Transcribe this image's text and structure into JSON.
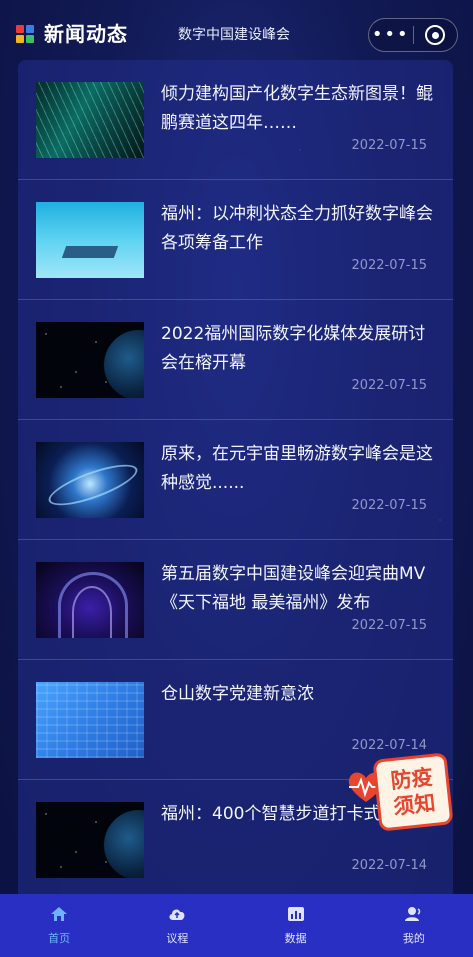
{
  "header": {
    "title": "新闻动态",
    "subtitle": "数字中国建设峰会",
    "more_label": "•••"
  },
  "news": [
    {
      "title": "倾力建构国产化数字生态新图景！鲲鹏赛道这四年……",
      "date": "2022-07-15",
      "thumb": "glowing-lines"
    },
    {
      "title": "福州：以冲刺状态全力抓好数字峰会各项筹备工作",
      "date": "2022-07-15",
      "thumb": "tech-platform"
    },
    {
      "title": "2022福州国际数字化媒体发展研讨会在榕开幕",
      "date": "2022-07-15",
      "thumb": "earth-space"
    },
    {
      "title": "原来，在元宇宙里畅游数字峰会是这种感觉......",
      "date": "2022-07-15",
      "thumb": "metaverse-orbit"
    },
    {
      "title": "第五届数字中国建设峰会迎宾曲MV《天下福地 最美福州》发布",
      "date": "2022-07-15",
      "thumb": "tunnel-arch"
    },
    {
      "title": "仓山数字党建新意浓",
      "date": "2022-07-14",
      "thumb": "blue-circuit"
    },
    {
      "title": "福州：400个智慧步道打卡式上线",
      "date": "2022-07-14",
      "thumb": "earth-space"
    }
  ],
  "epidemic_badge": {
    "line1": "防疫",
    "line2": "须知"
  },
  "tabbar": {
    "items": [
      {
        "label": "首页",
        "icon": "home-icon",
        "active": true
      },
      {
        "label": "议程",
        "icon": "cloud-icon",
        "active": false
      },
      {
        "label": "数据",
        "icon": "data-icon",
        "active": false
      },
      {
        "label": "我的",
        "icon": "user-icon",
        "active": false
      }
    ]
  },
  "colors": {
    "background": "#121a55",
    "panel": "#222e8c",
    "tabbar": "#2a2fc4",
    "active_tab": "#6fb3ff",
    "badge_red": "#e8452f",
    "date": "#8f98c9"
  }
}
